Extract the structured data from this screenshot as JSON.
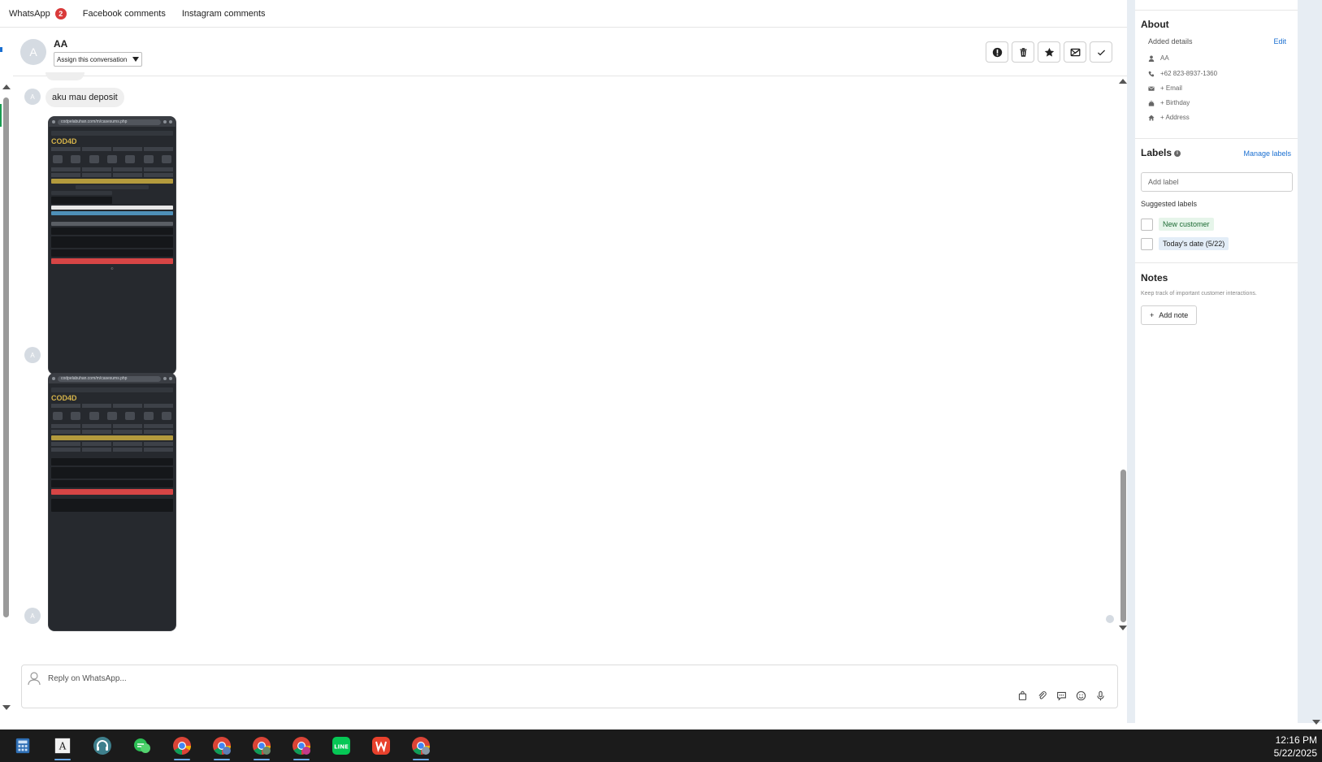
{
  "tabs": [
    {
      "label": "WhatsApp",
      "badge": "2"
    },
    {
      "label": "Facebook comments"
    },
    {
      "label": "Instagram comments"
    }
  ],
  "conversation": {
    "avatar_letter": "A",
    "contact_name": "AA",
    "assign_label": "Assign this conversation",
    "actions": [
      "alert-icon",
      "trash-icon",
      "star-icon",
      "archive-mail-icon",
      "check-icon"
    ]
  },
  "messages": {
    "avatar_letter": "A",
    "text_message": "aku mau deposit",
    "screenshot_1": {
      "url": "codpelabuhan.com/m/casesums.php",
      "logo": "COD4D"
    },
    "screenshot_2": {
      "url": "codpelabuhan.com/m/casesums.php",
      "logo": "COD4D"
    }
  },
  "reply": {
    "placeholder": "Reply on WhatsApp...",
    "tools": [
      "bag-icon",
      "paperclip-icon",
      "chat-bubble-icon",
      "emoji-icon",
      "microphone-icon"
    ]
  },
  "about": {
    "title": "About",
    "subtitle": "Added details",
    "edit_label": "Edit",
    "details": [
      {
        "icon": "person-icon",
        "text": "AA"
      },
      {
        "icon": "phone-icon",
        "text": "+62 823-8937-1360"
      },
      {
        "icon": "mail-icon",
        "text": "+ Email"
      },
      {
        "icon": "cake-icon",
        "text": "+ Birthday"
      },
      {
        "icon": "home-icon",
        "text": "+ Address"
      }
    ]
  },
  "labels": {
    "title": "Labels",
    "manage_label": "Manage labels",
    "add_placeholder": "Add label",
    "suggested_title": "Suggested labels",
    "suggested": [
      {
        "text": "New customer",
        "color": "#e6f5ea"
      },
      {
        "text": "Today's date (5/22)",
        "color": "#e3edf7"
      }
    ]
  },
  "notes": {
    "title": "Notes",
    "subtitle": "Keep track of important customer interactions.",
    "add_label": "Add note"
  },
  "taskbar": {
    "apps": [
      "calculator-icon",
      "text-editor-icon",
      "headset-app-icon",
      "whatsapp-icon",
      "chrome-icon",
      "chrome-profile-icon",
      "chrome-profile-icon",
      "chrome-profile-icon",
      "line-icon",
      "office-icon",
      "chrome-profile-icon"
    ],
    "time": "12:16 PM",
    "date": "5/22/2025"
  }
}
